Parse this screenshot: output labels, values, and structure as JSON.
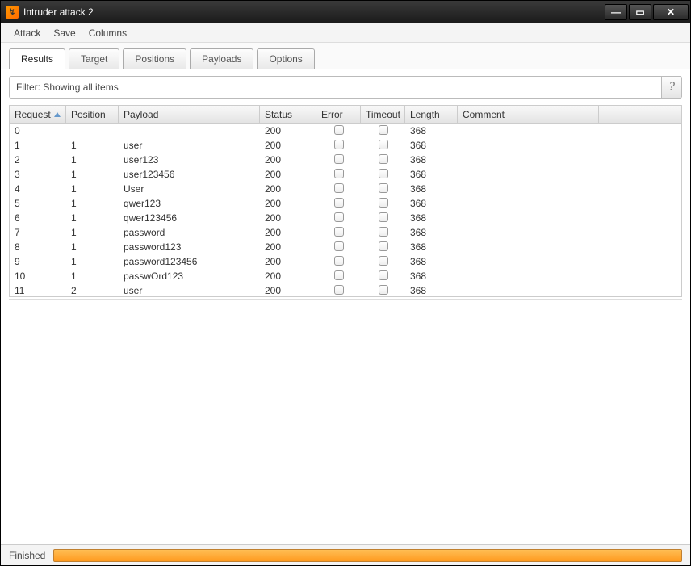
{
  "window": {
    "title": "Intruder attack 2"
  },
  "menu": {
    "attack": "Attack",
    "save": "Save",
    "columns": "Columns"
  },
  "tabs": {
    "results": "Results",
    "target": "Target",
    "positions": "Positions",
    "payloads": "Payloads",
    "options": "Options"
  },
  "filter": {
    "label": "Filter: Showing all items"
  },
  "columns": {
    "request": "Request",
    "position": "Position",
    "payload": "Payload",
    "status": "Status",
    "error": "Error",
    "timeout": "Timeout",
    "length": "Length",
    "comment": "Comment"
  },
  "rows": [
    {
      "request": "0",
      "position": "",
      "payload": "",
      "status": "200",
      "length": "368"
    },
    {
      "request": "1",
      "position": "1",
      "payload": "user",
      "status": "200",
      "length": "368"
    },
    {
      "request": "2",
      "position": "1",
      "payload": "user123",
      "status": "200",
      "length": "368"
    },
    {
      "request": "3",
      "position": "1",
      "payload": "user123456",
      "status": "200",
      "length": "368"
    },
    {
      "request": "4",
      "position": "1",
      "payload": "User",
      "status": "200",
      "length": "368"
    },
    {
      "request": "5",
      "position": "1",
      "payload": "qwer123",
      "status": "200",
      "length": "368"
    },
    {
      "request": "6",
      "position": "1",
      "payload": "qwer123456",
      "status": "200",
      "length": "368"
    },
    {
      "request": "7",
      "position": "1",
      "payload": "password",
      "status": "200",
      "length": "368"
    },
    {
      "request": "8",
      "position": "1",
      "payload": "password123",
      "status": "200",
      "length": "368"
    },
    {
      "request": "9",
      "position": "1",
      "payload": "password123456",
      "status": "200",
      "length": "368"
    },
    {
      "request": "10",
      "position": "1",
      "payload": "passwOrd123",
      "status": "200",
      "length": "368"
    },
    {
      "request": "11",
      "position": "2",
      "payload": "user",
      "status": "200",
      "length": "368"
    }
  ],
  "status": {
    "label": "Finished"
  }
}
